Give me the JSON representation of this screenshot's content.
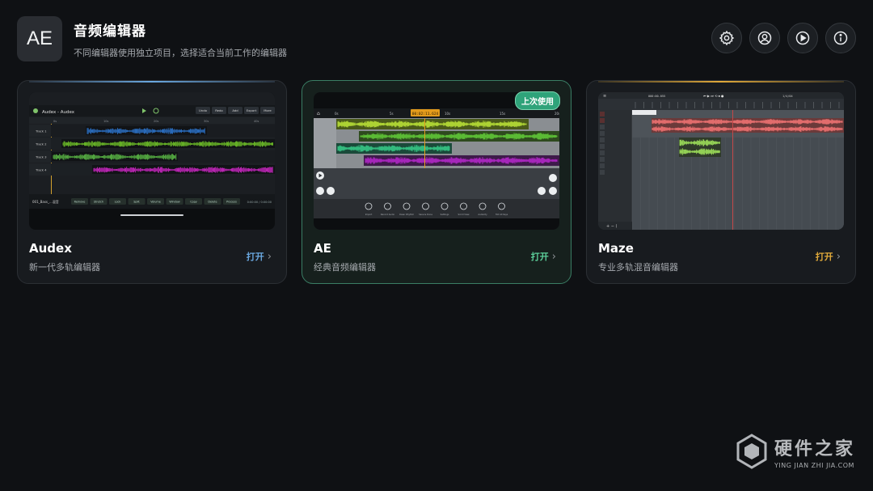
{
  "header": {
    "logo_text": "AE",
    "title": "音频编辑器",
    "subtitle": "不同编辑器使用独立项目，选择适合当前工作的编辑器"
  },
  "toolbar": {
    "buttons": [
      {
        "icon": "gear-icon"
      },
      {
        "icon": "user-icon"
      },
      {
        "icon": "play-icon"
      },
      {
        "icon": "info-icon"
      }
    ]
  },
  "cards": [
    {
      "name": "Audex",
      "desc": "新一代多轨编辑器",
      "open_label": "打开",
      "accent": "#6aa8e0",
      "preview": {
        "title": "Audex - Audex",
        "buttons": [
          "Undo",
          "Redo",
          "Add",
          "Export",
          "More"
        ],
        "tracks": [
          "Track 1",
          "Track 2",
          "Track 3",
          "Track 4"
        ],
        "footer_label": "001_Bass_...混音",
        "footer_buttons": [
          "Remove",
          "Stretch",
          "Lock",
          "Split",
          "Volume",
          "Window",
          "Copy",
          "Delete",
          "Process"
        ],
        "time": "0:00:00 / 0:00:00",
        "ruler": [
          "0s",
          "10s",
          "20s",
          "30s",
          "40s"
        ]
      }
    },
    {
      "name": "AE",
      "desc": "经典音频编辑器",
      "open_label": "打开",
      "accent": "#5ccf9a",
      "badge": "上次使用",
      "preview": {
        "time_marker": "00:02:11.624",
        "ruler": [
          "0s",
          "5s",
          "10s",
          "15s",
          "20s"
        ],
        "tools": [
          "Import",
          "Record Audio",
          "Clean Rhythm",
          "Save & Done",
          "Settings",
          "Scroll View",
          "Audacity",
          "Hot All Keys"
        ]
      }
    },
    {
      "name": "Maze",
      "desc": "专业多轨混音编辑器",
      "open_label": "打开",
      "accent": "#e0a93a",
      "preview": {
        "time": "000:00.055",
        "meter": "1/4/04"
      }
    }
  ],
  "watermark": {
    "cn": "硬件之家",
    "en": "YING JIAN ZHI JIA.COM"
  }
}
